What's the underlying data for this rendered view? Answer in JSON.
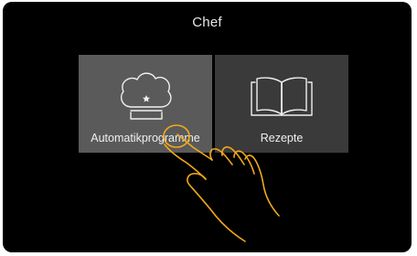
{
  "screen": {
    "title": "Chef"
  },
  "tiles": [
    {
      "label": "Automatikprogramme",
      "icon": "chef-hat-icon",
      "selected": true
    },
    {
      "label": "Rezepte",
      "icon": "open-book-icon",
      "selected": false
    }
  ],
  "gesture": {
    "icon": "tap-hand-icon",
    "color": "#f2a91c"
  },
  "colors": {
    "background": "#000000",
    "tile_selected": "#5a5a5a",
    "tile_default": "#3a3a3a",
    "text": "#f0f0f0"
  }
}
